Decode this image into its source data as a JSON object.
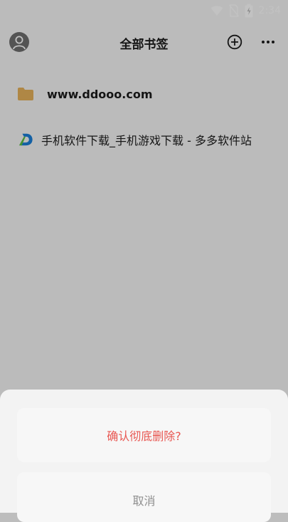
{
  "status_bar": {
    "time": "2:34",
    "icons": [
      "wifi-icon",
      "no-sim-icon",
      "battery-icon"
    ]
  },
  "header": {
    "title": "全部书签",
    "icons": [
      "avatar",
      "add-circle-icon",
      "more-icon"
    ]
  },
  "bookmarks": [
    {
      "title": "www.ddooo.com",
      "icon": "folder-icon"
    },
    {
      "title": "手机软件下载_手机游戏下载 - 多多软件站",
      "icon": "site-logo-icon"
    }
  ],
  "sheet": {
    "confirm_label": "确认彻底删除?",
    "cancel_label": "取消"
  },
  "colors": {
    "danger": "#e85752",
    "folder": "#e6b25b",
    "logo_blue": "#1a7fd8",
    "logo_green": "#5cc045"
  }
}
